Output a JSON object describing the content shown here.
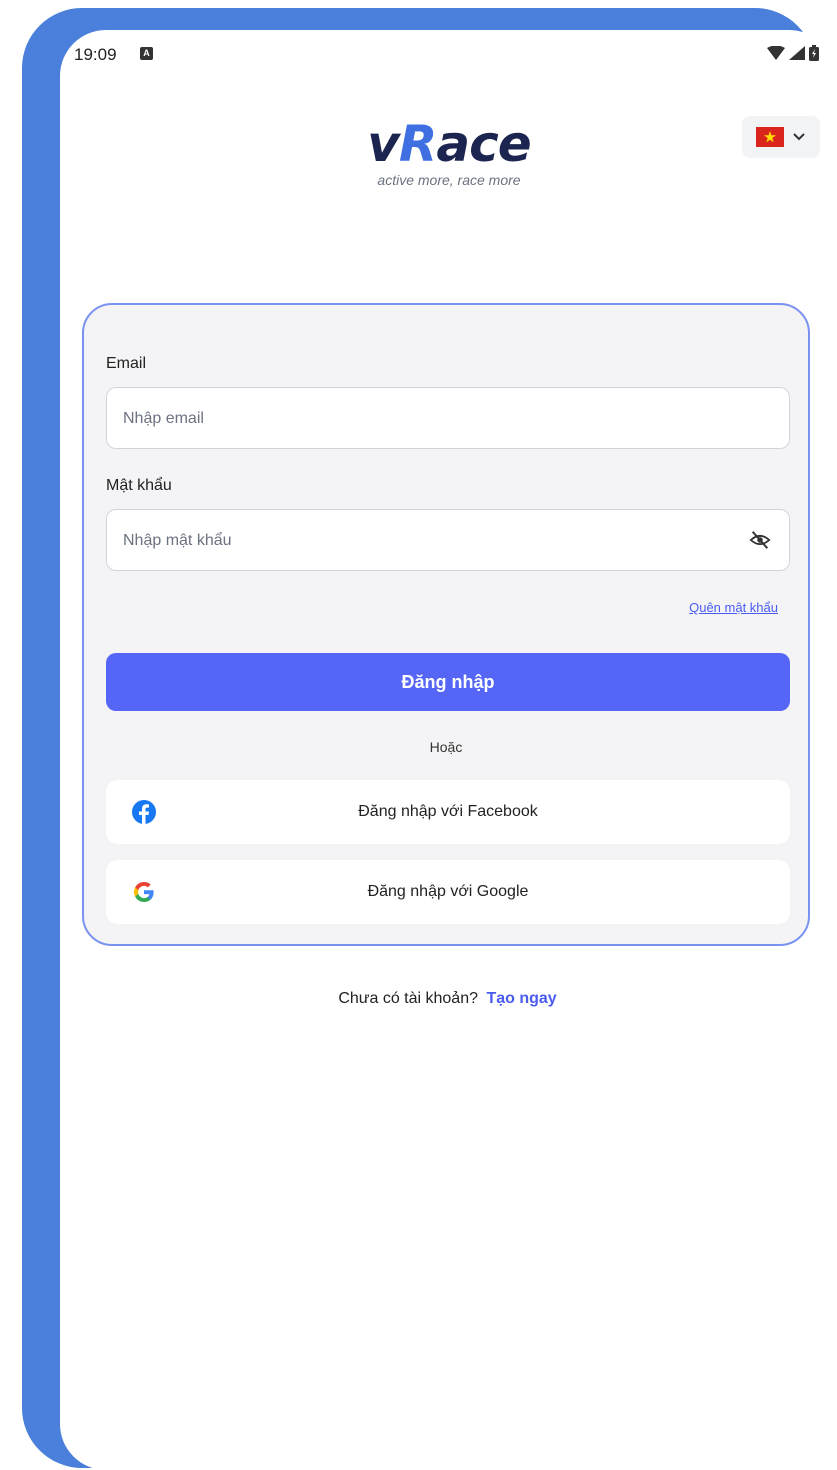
{
  "status_bar": {
    "time": "19:09",
    "notification_glyph": "A",
    "icons": [
      "wifi-icon",
      "signal-icon",
      "battery-icon"
    ]
  },
  "header": {
    "logo_text_before": "v",
    "logo_text_accent": "R",
    "logo_text_after": "ace",
    "tagline": "active more, race more",
    "language_flag": "vietnam-flag-icon"
  },
  "login_form": {
    "email_label": "Email",
    "email_placeholder": "Nhập email",
    "email_value": "",
    "password_label": "Mật khẩu",
    "password_placeholder": "Nhập mật khẩu",
    "password_value": "",
    "forgot_password": "Quên mật khẩu",
    "login_button": "Đăng nhập",
    "divider_text": "Hoặc",
    "facebook_button": "Đăng nhập với Facebook",
    "google_button": "Đăng nhập với Google"
  },
  "footer": {
    "no_account_text": "Chưa có tài khoản?",
    "create_link": "Tạo ngay"
  },
  "colors": {
    "primary": "#5566f6",
    "link": "#4a5cf0",
    "card_border": "#7b93f0",
    "frame": "#4a7fdc"
  }
}
